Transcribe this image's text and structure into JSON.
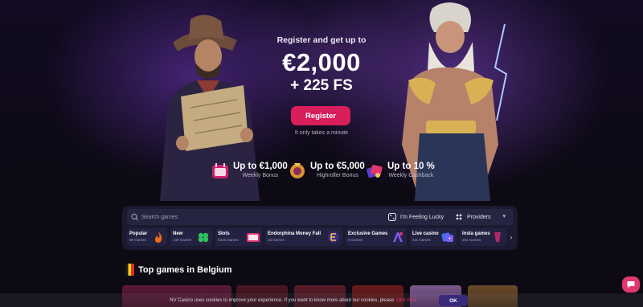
{
  "promo": {
    "pretext": "Register and get up to",
    "amount": "€2,000",
    "free_spins": "+ 225 FS",
    "register_label": "Register",
    "register_note": "It only takes a minute"
  },
  "bonuses": [
    {
      "title": "Up to €1,000",
      "subtitle": "Weekly Bonus",
      "icon": "weekly-bonus-icon"
    },
    {
      "title": "Up to €5,000",
      "subtitle": "Highroller Bonus",
      "icon": "highroller-bonus-icon"
    },
    {
      "title": "Up to 10 %",
      "subtitle": "Weekly Cashback",
      "icon": "cashback-icon"
    }
  ],
  "search": {
    "placeholder": "Search games",
    "lucky_label": "I'm Feeling Lucky",
    "providers_label": "Providers"
  },
  "categories": [
    {
      "label": "Popular",
      "count": "98 Games",
      "icon": "fire-icon"
    },
    {
      "label": "New",
      "count": "140 Games",
      "icon": "clover-icon"
    },
    {
      "label": "Slots",
      "count": "5415 Games",
      "icon": "slot-machine-icon"
    },
    {
      "label": "Endorphina Money Fall",
      "count": "16 Games",
      "icon": "endorphina-icon"
    },
    {
      "label": "Exclusive Games",
      "count": "6 Games",
      "icon": "exclusive-icon"
    },
    {
      "label": "Live casino",
      "count": "211 Games",
      "icon": "dice-icon"
    },
    {
      "label": "Insta games",
      "count": "191 Games",
      "icon": "insta-icon"
    }
  ],
  "top_games": {
    "title": "Top games in Belgium",
    "flag_colors": [
      "#1a1a1a",
      "#f8d21c",
      "#e32b2b"
    ]
  },
  "cookie": {
    "text": "NV Casino uses cookies to improve your experience. If you want to know more about our cookies, please",
    "link": "click here",
    "ok_label": "OK"
  },
  "colors": {
    "accent": "#d81e5b",
    "panel": "#1b1a31",
    "background": "#0d0a14"
  }
}
